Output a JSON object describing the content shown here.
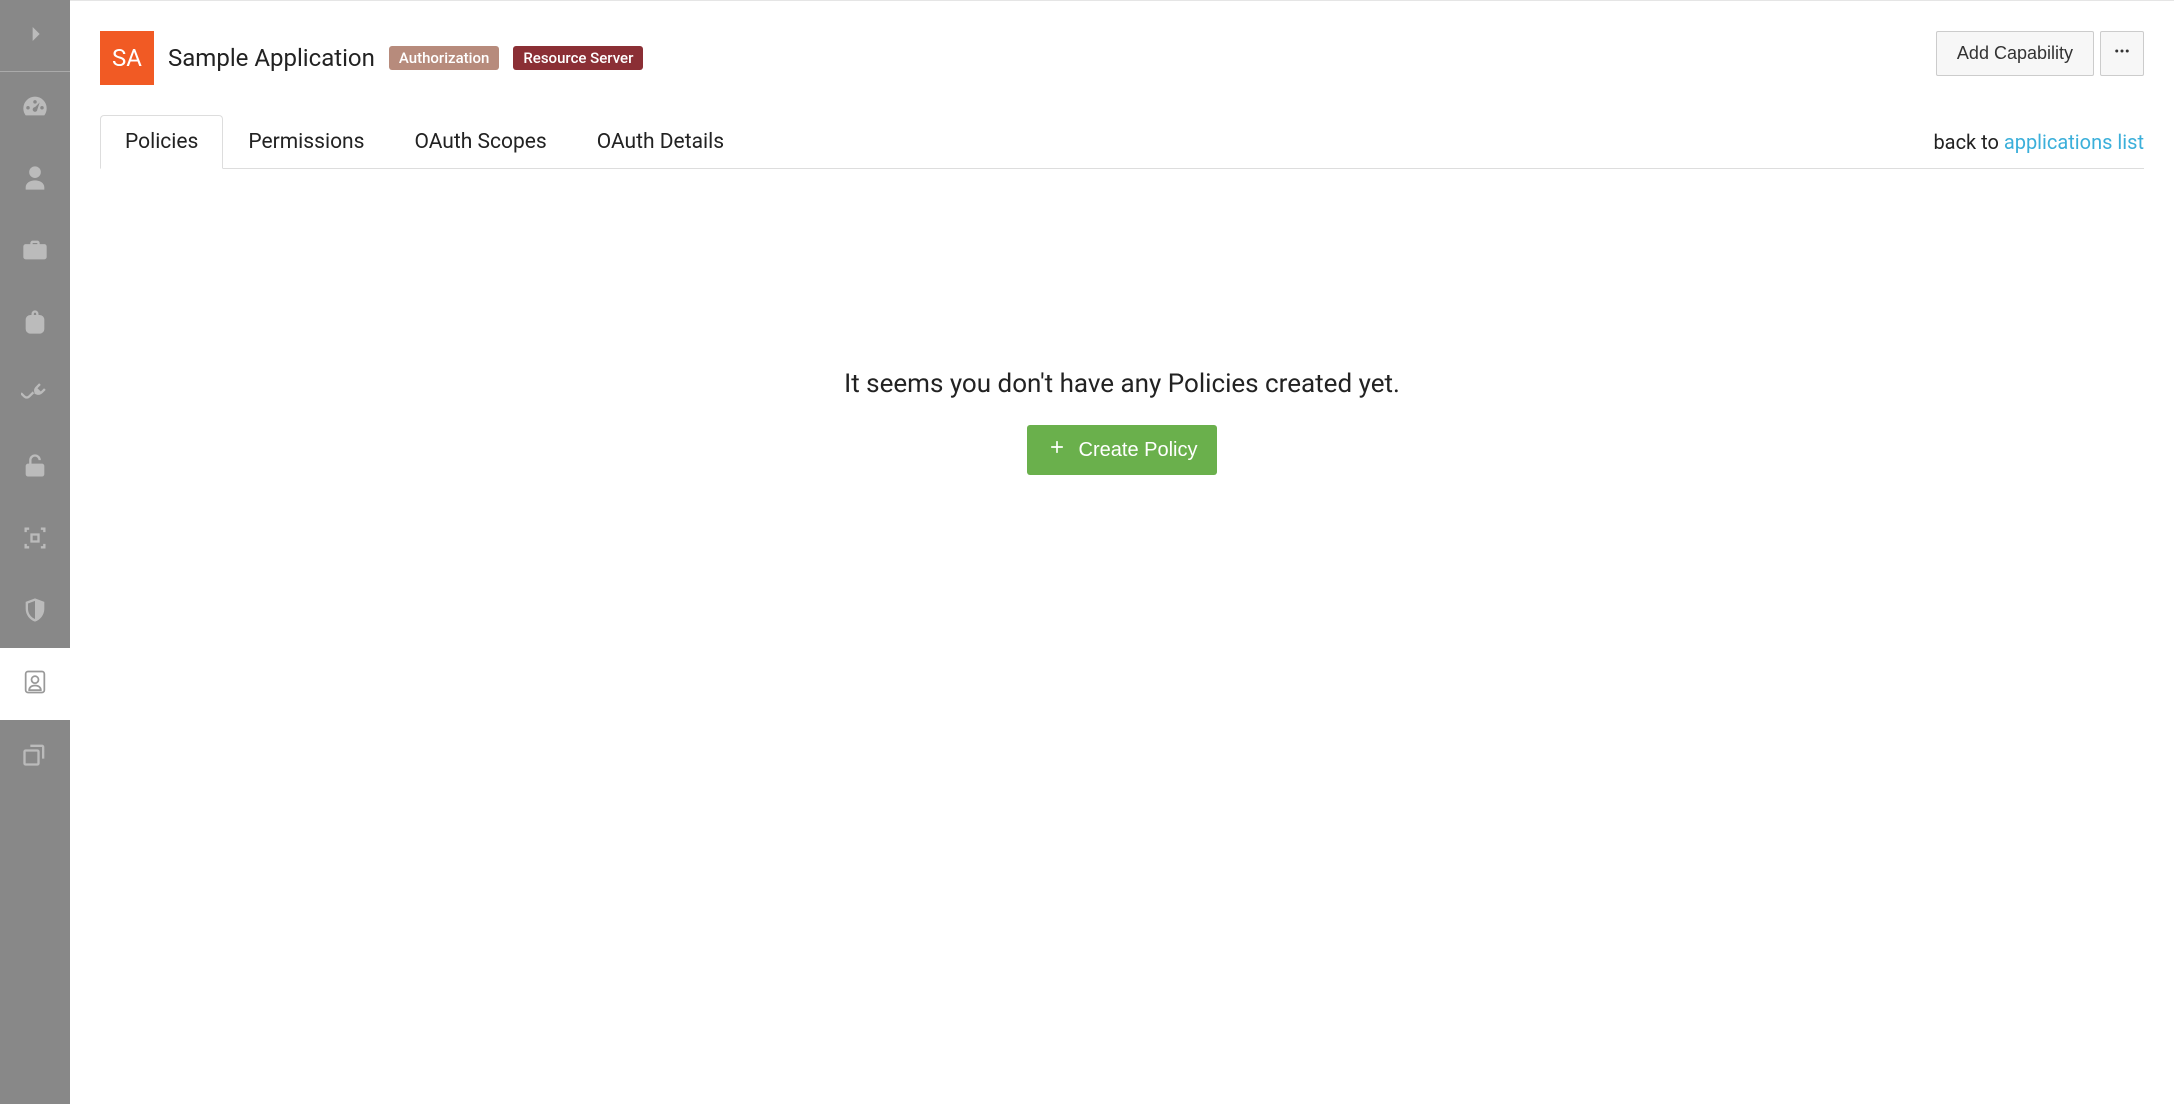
{
  "sidebar": {
    "items": [
      {
        "name": "toggle",
        "active": false
      },
      {
        "name": "dashboard",
        "active": false
      },
      {
        "name": "users",
        "active": false
      },
      {
        "name": "briefcase",
        "active": false
      },
      {
        "name": "backpack",
        "active": false
      },
      {
        "name": "plugins",
        "active": false
      },
      {
        "name": "security",
        "active": false
      },
      {
        "name": "layers",
        "active": false
      },
      {
        "name": "shield",
        "active": false
      },
      {
        "name": "contacts",
        "active": true
      },
      {
        "name": "copy",
        "active": false
      }
    ]
  },
  "header": {
    "app_icon_initials": "SA",
    "app_title": "Sample Application",
    "badges": {
      "authorization": "Authorization",
      "resource_server": "Resource Server"
    },
    "add_capability_label": "Add Capability"
  },
  "tabs": {
    "items": [
      {
        "label": "Policies",
        "active": true
      },
      {
        "label": "Permissions",
        "active": false
      },
      {
        "label": "OAuth Scopes",
        "active": false
      },
      {
        "label": "OAuth Details",
        "active": false
      }
    ],
    "back_prefix": "back to ",
    "back_link": "applications list"
  },
  "empty_state": {
    "heading": "It seems you don't have any Policies created yet.",
    "create_label": "Create Policy"
  },
  "colors": {
    "sidebar_bg": "#888888",
    "app_icon_bg": "#f15a24",
    "badge_auth_bg": "#b78b7c",
    "badge_resource_bg": "#8b2f35",
    "create_bg": "#6ab04c",
    "link": "#3bafda"
  }
}
